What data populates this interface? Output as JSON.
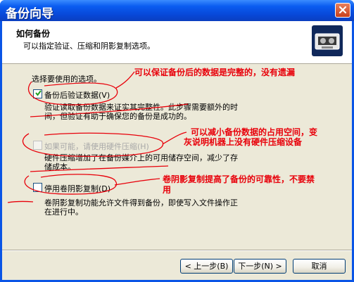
{
  "window": {
    "title": "备份向导"
  },
  "header": {
    "title": "如何备份",
    "subtitle": "可以指定验证、压缩和阴影复制选项。"
  },
  "prompt": "选择要使用的选项。",
  "options": [
    {
      "label": "备份后验证数据(V)",
      "checked": true,
      "enabled": true,
      "desc1": "验证读取备份数据来证实其完整性。此步骤需要额外的时",
      "desc2": "间，但验证有助于确保您的备份是成功的。"
    },
    {
      "label": "如果可能，请使用硬件压缩(H)",
      "checked": false,
      "enabled": false,
      "desc1": "硬件压缩增加了在备份媒介上的可用储存空间，减少了存",
      "desc2": "储成本。"
    },
    {
      "label": "停用卷阴影复制(D)",
      "checked": false,
      "enabled": true,
      "desc1": "卷阴影复制功能允许文件得到备份，即使写入文件操作正",
      "desc2": "在进行中。"
    }
  ],
  "annotations": [
    {
      "line1": "可以保证备份后的数据是完整的，没有遗漏"
    },
    {
      "line1": "可以减小备份数据的占用空间，变",
      "line2": "灰说明机器上没有硬件压缩设备"
    },
    {
      "line1": "卷阴影复制提高了备份的可靠性，不要禁",
      "line2": "用"
    }
  ],
  "buttons": {
    "back": "< 上一步(B)",
    "next": "下一步(N) >",
    "cancel": "取消"
  },
  "colors": {
    "annotation": "#e8000a",
    "titlebar": "#0a55e6",
    "face": "#ece9d8"
  }
}
